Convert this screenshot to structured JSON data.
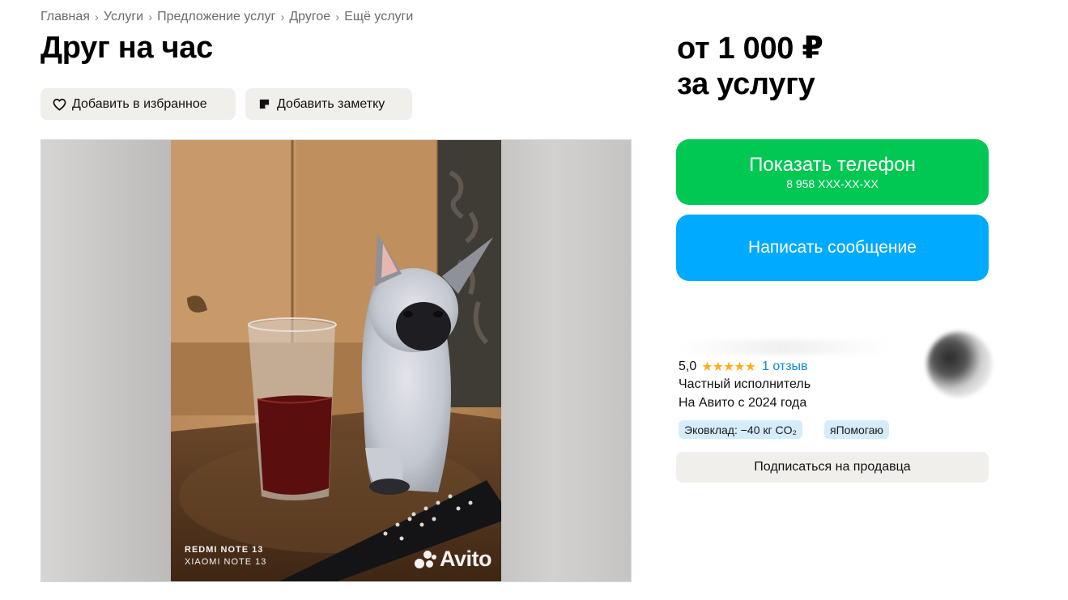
{
  "breadcrumb": [
    "Главная",
    "Услуги",
    "Предложение услуг",
    "Другое",
    "Ещё услуги"
  ],
  "title": "Друг на час",
  "actions": {
    "favorite_label": "Добавить в избранное",
    "favorite_icon": "heart-icon",
    "note_label": "Добавить заметку",
    "note_icon": "note-icon"
  },
  "gallery": {
    "watermark_device_1": "REDMI NOTE 13",
    "watermark_device_2": "XIAOMI NOTE 13",
    "watermark_brand": "Avito"
  },
  "price": {
    "line1": "от 1 000 ₽",
    "line2": "за услугу"
  },
  "contact": {
    "phone_label": "Показать телефон",
    "phone_number": "8 958 XXX-XX-XX",
    "phone_color": "#00c853",
    "message_label": "Написать сообщение",
    "message_color": "#00aaff"
  },
  "seller": {
    "rating": "5,0",
    "stars": "★★★★★",
    "reviews": "1 отзыв",
    "type": "Частный исполнитель",
    "since": "На Авито с 2024 года",
    "badges": [
      "Эковклад: −40 кг CO₂",
      "яПомогаю"
    ],
    "subscribe_label": "Подписаться на продавца"
  }
}
